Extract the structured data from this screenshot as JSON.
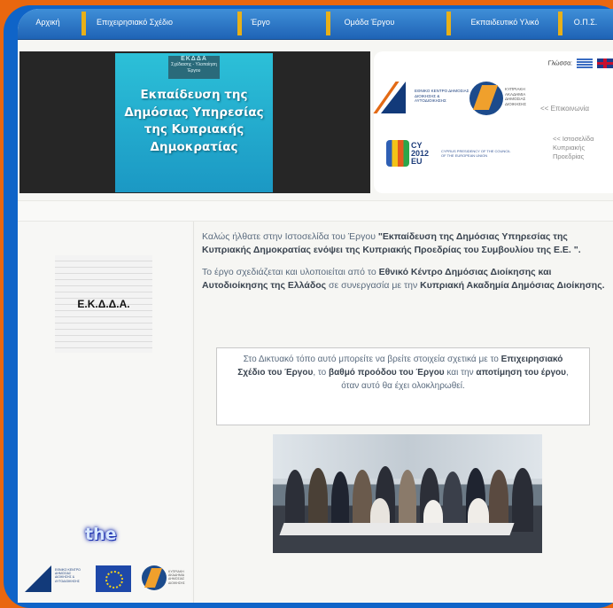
{
  "nav": {
    "items": [
      {
        "label": "Αρχική"
      },
      {
        "label": "Επιχειρησιακό Σχέδιο"
      },
      {
        "label": "Έργο"
      },
      {
        "label": "Ομάδα Έργου"
      },
      {
        "label": "Εκπαιδευτικό Υλικό"
      },
      {
        "label": "Ο.Π.Σ."
      }
    ]
  },
  "banner": {
    "tag_title": "ΕΚΔΔΑ",
    "tag_subtitle": "Σχέδιασης - Υλοποίηση Έργου",
    "title": "Εκπαίδευση της Δημόσιας Υπηρεσίας της Κυπριακής Δημοκρατίας"
  },
  "partners": {
    "language_label": "Γλώσσα:",
    "ekdda_logo_text": "ΕΘΝΙΚΟ ΚΕΝΤΡΟ ΔΗΜΟΣΙΑΣ ΔΙΟΙΚΗΣΗΣ & ΑΥΤΟΔΙΟΙΚΗΣΗΣ",
    "cypa_logo_text": "ΚΥΠΡΙΑΚΗ ΑΚΑΔΗΜΙΑ ΔΗΜΟΣΙΑΣ ΔΙΟΙΚΗΣΗΣ",
    "contact_link": "<< Επικοινωνία",
    "cy_year_top": "CY",
    "cy_year": "2012",
    "cy_year_bottom": "EU",
    "cy_desc": "CYPRUS PRESIDENCY OF THE COUNCIL OF THE EUROPEAN UNION",
    "presidency_link": "<< Ιστοσελίδα Κυπριακής Προεδρίας"
  },
  "sidebar": {
    "notepad_label": "Ε.Κ.Δ.Δ.Α.",
    "the_word": "the",
    "footer_logo_1_text": "ΕΘΝΙΚΟ ΚΕΝΤΡΟ ΔΗΜΟΣΙΑΣ ΔΙΟΙΚΗΣΗΣ & ΑΥΤΟΔΙΟΙΚΗΣΗΣ",
    "footer_logo_3_text": "ΚΥΠΡΙΑΚΗ ΑΚΑΔΗΜΙΑ ΔΗΜΟΣΙΑΣ ΔΙΟΙΚΗΣΗΣ"
  },
  "main": {
    "p1_pre": "Καλώς ήλθατε στην Ιστοσελίδα του Έργου  ",
    "p1_bold": "\"Εκπαίδευση της Δημόσιας Υπηρεσίας της Κυπριακής Δημοκρατίας ενόψει της Κυπριακής Προεδρίας του Συμβουλίου της Ε.Ε. \".",
    "p2_pre": "Το έργο σχεδιάζεται και υλοποιείται από το ",
    "p2_bold1": "Εθνικό Κέντρο Δημόσιας Διοίκησης και Αυτοδιοίκησης της Ελλάδος",
    "p2_mid": " σε συνεργασία με την ",
    "p2_bold2": "Κυπριακή Ακαδημία Δημόσιας Διοίκησης.",
    "info_1": "Στο Δικτυακό τόπο αυτό μπορείτε να βρείτε στοιχεία σχετικά με το ",
    "info_b1": "Επιχειρησιακό Σχέδιο του Έργου",
    "info_2": ", το ",
    "info_b2": "βαθμό προόδου του Έργου",
    "info_3": " και την ",
    "info_b3": "αποτίμηση του έργου",
    "info_4": ", όταν αυτό θα έχει ολοκληρωθεί."
  }
}
